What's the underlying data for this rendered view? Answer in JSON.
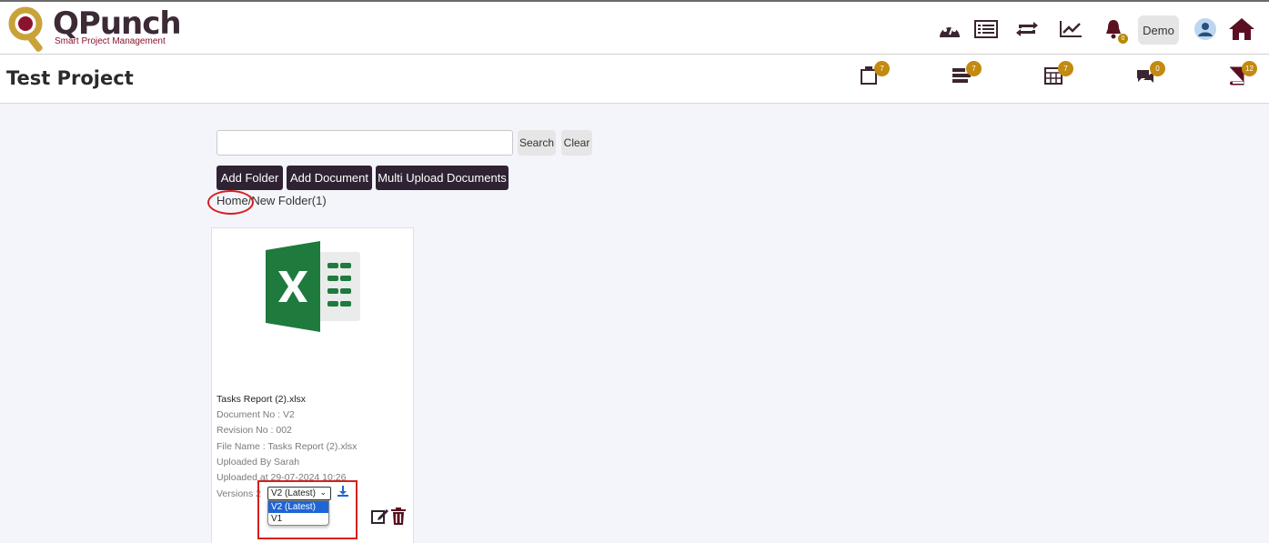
{
  "brand": {
    "name": "QPunch",
    "tagline": "Smart Project Management"
  },
  "header": {
    "icons": [
      "dashboard-icon",
      "list-icon",
      "sync-icon",
      "chart-line-icon",
      "bell-icon",
      "avatar",
      "home-icon"
    ],
    "user_label": "Demo",
    "notification_count": "0"
  },
  "project": {
    "title": "Test Project",
    "nav": [
      {
        "icon": "document-icon",
        "badge": "7"
      },
      {
        "icon": "tasks-icon",
        "badge": "7"
      },
      {
        "icon": "calendar-icon",
        "badge": "7"
      },
      {
        "icon": "chat-icon",
        "badge": "0"
      },
      {
        "icon": "book-icon",
        "badge": "12"
      }
    ]
  },
  "search": {
    "value": "",
    "placeholder": "",
    "search_label": "Search",
    "clear_label": "Clear"
  },
  "actions": {
    "add_folder": "Add Folder",
    "add_document": "Add Document",
    "multi_upload": "Multi Upload Documents"
  },
  "breadcrumb": {
    "home": "Home",
    "separator": "/",
    "current": "New Folder(1)"
  },
  "document": {
    "title": "Tasks Report (2).xlsx",
    "document_no": "Document No : V2",
    "revision_no": "Revision No : 002",
    "file_name": "File Name : Tasks Report (2).xlsx",
    "uploaded_by": "Uploaded By Sarah",
    "uploaded_at": "Uploaded at 29-07-2024 10:26",
    "versions_label": "Versions 2",
    "selected_version": "V2 (Latest)",
    "version_options": [
      "V2 (Latest)",
      "V1"
    ]
  },
  "colors": {
    "brand_dark": "#2f2333",
    "accent_red": "#d42020",
    "badge_gold": "#c28a10",
    "excel_green": "#1f7a3d"
  }
}
